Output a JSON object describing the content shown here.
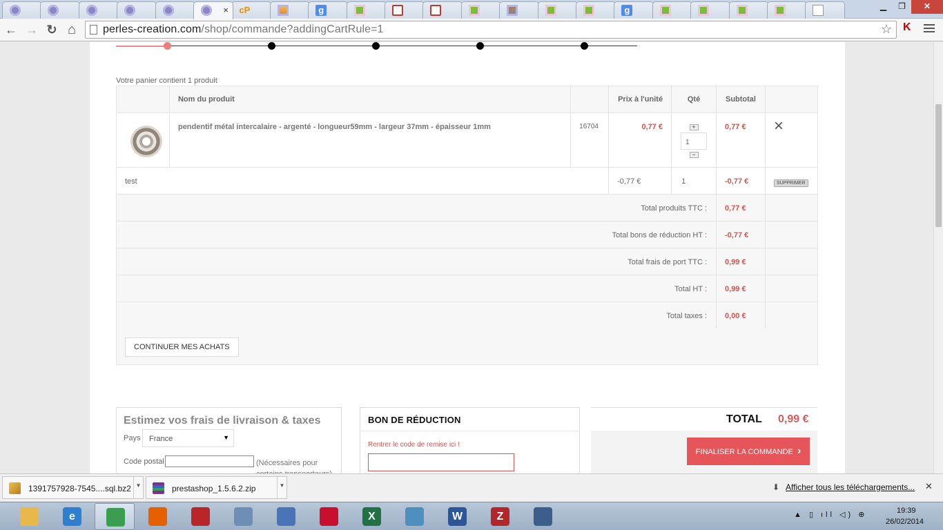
{
  "browser": {
    "tabs": [
      {
        "icon": "prestashop-favicon",
        "kind": "ps"
      },
      {
        "icon": "prestashop-favicon",
        "kind": "ps"
      },
      {
        "icon": "prestashop-favicon",
        "kind": "ps"
      },
      {
        "icon": "prestashop-favicon",
        "kind": "ps"
      },
      {
        "icon": "prestashop-favicon",
        "kind": "ps"
      },
      {
        "icon": "prestashop-favicon",
        "kind": "ps",
        "active": true,
        "close": "×"
      },
      {
        "icon": "cpanel-favicon",
        "kind": "cp",
        "text": "cP"
      },
      {
        "icon": "phpmyadmin-favicon",
        "kind": "pma"
      },
      {
        "icon": "google-favicon",
        "kind": "g",
        "text": "g"
      },
      {
        "icon": "green-page-favicon",
        "kind": "green"
      },
      {
        "icon": "red-box-favicon",
        "kind": "red"
      },
      {
        "icon": "red-box-favicon",
        "kind": "red"
      },
      {
        "icon": "green-page-favicon",
        "kind": "green"
      },
      {
        "icon": "box-favicon",
        "kind": "box"
      },
      {
        "icon": "green-page-favicon",
        "kind": "green"
      },
      {
        "icon": "green-page-favicon",
        "kind": "green"
      },
      {
        "icon": "google-favicon",
        "kind": "g",
        "text": "g"
      },
      {
        "icon": "green-page-favicon",
        "kind": "green"
      },
      {
        "icon": "green-page-favicon",
        "kind": "green"
      },
      {
        "icon": "green-page-favicon",
        "kind": "green"
      },
      {
        "icon": "green-page-favicon",
        "kind": "green"
      },
      {
        "icon": "blank-page-favicon",
        "kind": "page"
      }
    ],
    "window_controls": {
      "minimize": "▁",
      "restore": "❐",
      "close": "✕"
    },
    "nav": {
      "back": "←",
      "forward": "→",
      "reload": "↻",
      "home": "⌂"
    },
    "url_host": "perles-creation.com",
    "url_path": "/shop/commande?addingCartRule=1",
    "star": "☆",
    "ext": "K"
  },
  "page": {
    "cart_summary": "Votre panier contient 1 produit",
    "table_headers": {
      "product": "Nom du produit",
      "unit_price": "Prix à l'unité",
      "qty": "Qté",
      "subtotal": "Subtotal"
    },
    "product": {
      "name": "pendentif métal intercalaire - argenté - longueur59mm - largeur 37mm - épaisseur 1mm",
      "ref": "16704",
      "unit_price": "0,77 €",
      "qty": "1",
      "qty_plus": "+",
      "qty_minus": "−",
      "subtotal": "0,77 €",
      "delete": "×"
    },
    "voucher": {
      "name": "test",
      "unit_price": "-0,77 €",
      "qty": "1",
      "subtotal": "-0,77 €",
      "delete_label": "SUPPRIMER"
    },
    "totals": [
      {
        "label": "Total produits TTC :",
        "value": "0,77 €"
      },
      {
        "label": "Total bons de réduction HT :",
        "value": "-0,77 €"
      },
      {
        "label": "Total frais de port TTC :",
        "value": "0,99 €"
      },
      {
        "label": "Total HT :",
        "value": "0,99 €"
      },
      {
        "label": "Total taxes :",
        "value": "0,00 €"
      }
    ],
    "continue_label": "CONTINUER MES ACHATS",
    "shipping": {
      "title": "Estimez vos frais de livraison & taxes",
      "country_label": "Pays",
      "country_value": "France",
      "postcode_label": "Code postal",
      "postcode_value": "",
      "postcode_note": "(Nécessaires pour certains transporteurs)"
    },
    "coupon": {
      "title": "BON DE RÉDUCTION",
      "hint": "Rentrer le code de remise ici !",
      "value": ""
    },
    "total": {
      "label": "TOTAL",
      "value": "0,99 €",
      "finalize_label": "FINALISER LA COMMANDE",
      "finalize_arrow": "›"
    },
    "colors": {
      "accent": "#e5555a",
      "price": "#d9534f"
    }
  },
  "downloads": {
    "items": [
      {
        "name": "1391757928-7545....sql.bz2",
        "icon": "archive-icon"
      },
      {
        "name": "prestashop_1.5.6.2.zip",
        "icon": "winrar-icon"
      }
    ],
    "show_all": "Afficher tous les téléchargements...",
    "close": "✕"
  },
  "taskbar": {
    "apps": [
      {
        "icon": "explorer-icon",
        "color": "#e8b84a"
      },
      {
        "icon": "internet-explorer-icon",
        "color": "#2f7fd0",
        "text": "e"
      },
      {
        "icon": "chrome-icon",
        "color": "#3a9d4f",
        "open": true
      },
      {
        "icon": "firefox-icon",
        "color": "#e66000"
      },
      {
        "icon": "calendar-app-icon",
        "color": "#b8262a"
      },
      {
        "icon": "calculator-icon",
        "color": "#6c8fb3"
      },
      {
        "icon": "sync-app-icon",
        "color": "#4a74b8"
      },
      {
        "icon": "acrobat-icon",
        "color": "#c8102e"
      },
      {
        "icon": "excel-icon",
        "color": "#207245",
        "text": "X"
      },
      {
        "icon": "photo-viewer-icon",
        "color": "#4f8fc0"
      },
      {
        "icon": "word-icon",
        "color": "#2b579a",
        "text": "W"
      },
      {
        "icon": "filezilla-icon",
        "color": "#b3262a",
        "text": "Z"
      },
      {
        "icon": "media-player-icon",
        "color": "#3b5e8c"
      }
    ],
    "tray": "▲ ▯ ıll ◁) ⊕",
    "time": "19:39",
    "date": "26/02/2014"
  }
}
